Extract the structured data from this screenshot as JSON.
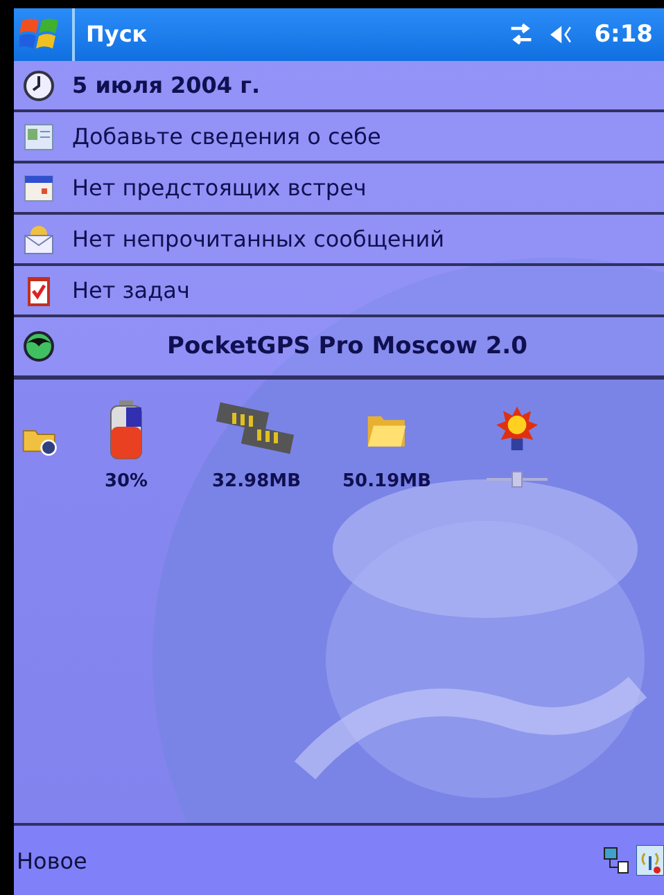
{
  "title_bar": {
    "title": "Пуск",
    "time": "6:18"
  },
  "rows": [
    {
      "kind": "date",
      "text": "5 июля 2004 г."
    },
    {
      "kind": "owner",
      "text": "Добавьте сведения о себе"
    },
    {
      "kind": "calendar",
      "text": "Нет предстоящих встреч"
    },
    {
      "kind": "messages",
      "text": "Нет непрочитанных сообщений"
    },
    {
      "kind": "tasks",
      "text": "Нет задач"
    },
    {
      "kind": "plugin",
      "text": "PocketGPS Pro Moscow 2.0"
    }
  ],
  "status_icons": [
    {
      "kind": "settings"
    },
    {
      "kind": "battery",
      "label": "30%"
    },
    {
      "kind": "memory",
      "label": "32.98MB"
    },
    {
      "kind": "storage",
      "label": "50.19MB"
    },
    {
      "kind": "backlight",
      "level": 0.5
    }
  ],
  "bottom_bar": {
    "label": "Новое"
  }
}
